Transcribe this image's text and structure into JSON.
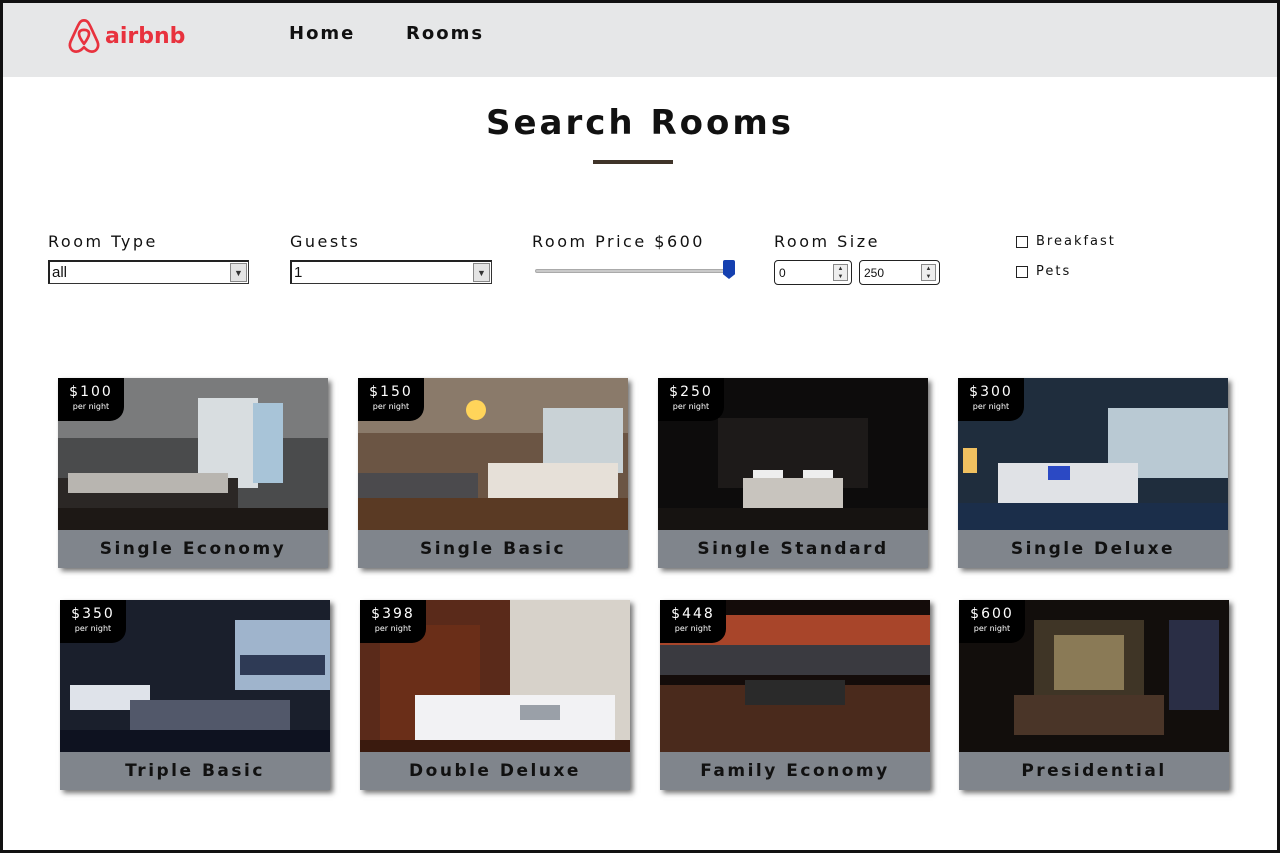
{
  "brand": {
    "name": "airbnb",
    "color": "#e8323e"
  },
  "nav": {
    "links": [
      {
        "label": "Home"
      },
      {
        "label": "Rooms"
      }
    ]
  },
  "page": {
    "title": "Search Rooms"
  },
  "filters": {
    "room_type": {
      "label": "Room Type",
      "value": "all"
    },
    "guests": {
      "label": "Guests",
      "value": "1"
    },
    "price": {
      "label": "Room Price $600",
      "value": 600,
      "level": 1.0
    },
    "size": {
      "label": "Room Size",
      "min": "0",
      "max": "250"
    },
    "breakfast": {
      "label": "Breakfast",
      "checked": false
    },
    "pets": {
      "label": "Pets",
      "checked": false
    }
  },
  "rooms": [
    {
      "name": "Single Economy",
      "price": "$100",
      "per": "per night"
    },
    {
      "name": "Single Basic",
      "price": "$150",
      "per": "per night"
    },
    {
      "name": "Single Standard",
      "price": "$250",
      "per": "per night"
    },
    {
      "name": "Single Deluxe",
      "price": "$300",
      "per": "per night"
    },
    {
      "name": "Triple Basic",
      "price": "$350",
      "per": "per night"
    },
    {
      "name": "Double Deluxe",
      "price": "$398",
      "per": "per night"
    },
    {
      "name": "Family Economy",
      "price": "$448",
      "per": "per night"
    },
    {
      "name": "Presidential",
      "price": "$600",
      "per": "per night"
    }
  ]
}
